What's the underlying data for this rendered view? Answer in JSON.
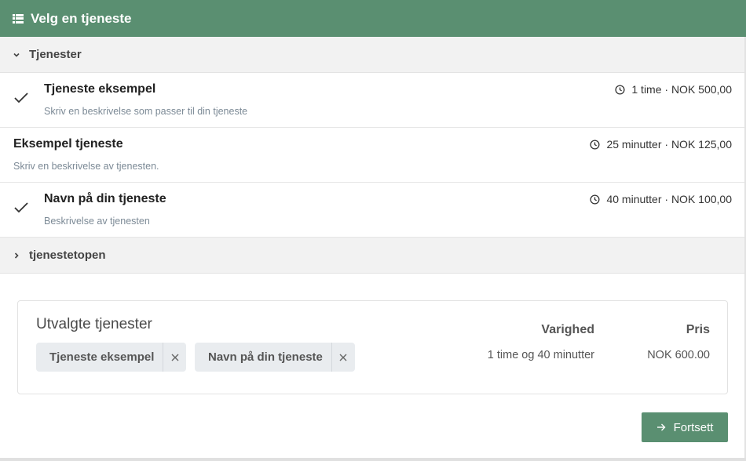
{
  "header": {
    "title": "Velg en tjeneste",
    "icon": "list-icon"
  },
  "groups": [
    {
      "label": "Tjenester",
      "expanded": true
    },
    {
      "label": "tjenestetopen",
      "expanded": false
    }
  ],
  "services": [
    {
      "name": "Tjeneste eksempel",
      "description": "Skriv en beskrivelse som passer til din tjeneste",
      "duration_price": "1 time · NOK 500,00",
      "selected": true
    },
    {
      "name": "Eksempel tjeneste",
      "description": "Skriv en beskrivelse av tjenesten.",
      "duration_price": "25 minutter · NOK 125,00",
      "selected": false
    },
    {
      "name": "Navn på din tjeneste",
      "description": "Beskrivelse av tjenesten",
      "duration_price": "40 minutter · NOK 100,00",
      "selected": true
    }
  ],
  "summary": {
    "title": "Utvalgte tjenester",
    "chips": [
      "Tjeneste eksempel",
      "Navn på din tjeneste"
    ],
    "duration_header": "Varighed",
    "price_header": "Pris",
    "duration_value": "1 time og 40 minutter",
    "price_value": "NOK 600.00"
  },
  "continue_label": "Fortsett",
  "colors": {
    "accent": "#5a8f71",
    "group_bg": "#f2f2f2",
    "chip_bg": "#e9ecef"
  }
}
